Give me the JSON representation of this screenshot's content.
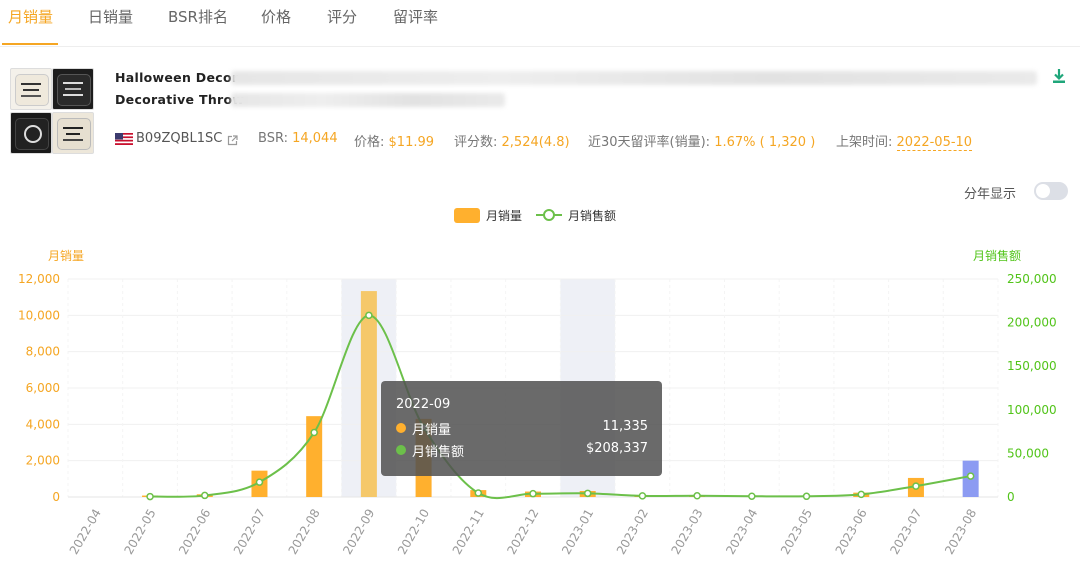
{
  "tabs": [
    {
      "label": "月销量"
    },
    {
      "label": "日销量"
    },
    {
      "label": "BSR排名"
    },
    {
      "label": "价格"
    },
    {
      "label": "评分"
    },
    {
      "label": "留评率"
    }
  ],
  "product": {
    "title_line1": "Halloween  Decor",
    "title_line2": "Decorative Throw",
    "asin": "B09ZQBL1SC",
    "bsr_label": "BSR:",
    "bsr_value": "14,044",
    "price_label": "价格:",
    "price_value": "$11.99",
    "reviews_label": "评分数:",
    "reviews_value": "2,524(4.8)",
    "review_rate_label": "近30天留评率(销量):",
    "review_rate_value": "1.67% ( 1,320 )",
    "launch_label": "上架时间:",
    "launch_value": "2022-05-10"
  },
  "controls": {
    "year_toggle_label": "分年显示",
    "year_toggle_on": false
  },
  "colors": {
    "accent": "#f5a623",
    "bar": "#ffb02e",
    "bar_highlight": "#f5c86a",
    "bar_last": "#8c9bf2",
    "line": "#6cc04a",
    "green_axis": "#52c41a"
  },
  "tooltip": {
    "title": "2022-09",
    "rows": [
      {
        "label": "月销量",
        "value": "11,335"
      },
      {
        "label": "月销售额",
        "value": "$208,337"
      }
    ]
  },
  "chart_data": {
    "type": "bar",
    "legend": [
      "月销量",
      "月销售额"
    ],
    "left_axis_label": "月销量",
    "right_axis_label": "月销售额",
    "categories": [
      "2022-04",
      "2022-05",
      "2022-06",
      "2022-07",
      "2022-08",
      "2022-09",
      "2022-10",
      "2022-11",
      "2022-12",
      "2023-01",
      "2023-02",
      "2023-03",
      "2023-04",
      "2023-05",
      "2023-06",
      "2023-07",
      "2023-08"
    ],
    "ylim_left": [
      0,
      12000
    ],
    "yticks_left": [
      "0",
      "2,000",
      "4,000",
      "6,000",
      "8,000",
      "10,000",
      "12,000"
    ],
    "ylim_right": [
      0,
      250000
    ],
    "yticks_right": [
      "0",
      "50,000",
      "100,000",
      "150,000",
      "200,000",
      "250,000"
    ],
    "series": [
      {
        "name": "月销量",
        "type": "bar",
        "values": [
          0,
          80,
          150,
          1450,
          4450,
          11335,
          4300,
          380,
          300,
          330,
          110,
          100,
          70,
          60,
          240,
          1050,
          2000
        ]
      },
      {
        "name": "月销售额",
        "type": "line",
        "values": [
          null,
          500,
          1800,
          17000,
          74000,
          208337,
          80000,
          4600,
          3800,
          4200,
          1300,
          1400,
          900,
          800,
          3000,
          12500,
          24000
        ]
      }
    ],
    "highlight_bands": [
      "2022-09",
      "2023-01"
    ],
    "grid": true
  }
}
